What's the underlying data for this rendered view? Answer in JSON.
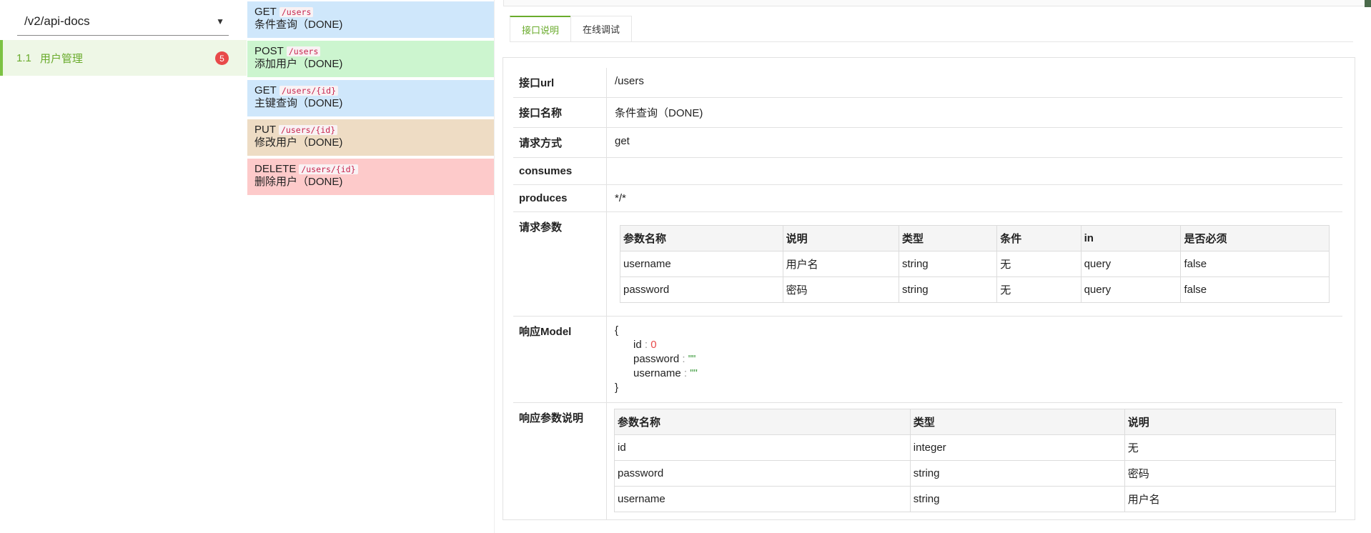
{
  "sidebar": {
    "select_value": "/v2/api-docs",
    "group": {
      "number": "1.1",
      "label": "用户管理",
      "badge": "5"
    }
  },
  "operations": [
    {
      "method": "GET",
      "path": "/users",
      "summary": "条件查询（DONE)"
    },
    {
      "method": "POST",
      "path": "/users",
      "summary": "添加用户（DONE)"
    },
    {
      "method": "GET",
      "path": "/users/{id}",
      "summary": "主键查询（DONE)"
    },
    {
      "method": "PUT",
      "path": "/users/{id}",
      "summary": "修改用户（DONE)"
    },
    {
      "method": "DELETE",
      "path": "/users/{id}",
      "summary": "删除用户（DONE)"
    }
  ],
  "tabs": [
    "接口说明",
    "在线调试"
  ],
  "details": {
    "url_label": "接口url",
    "url_value": "/users",
    "name_label": "接口名称",
    "name_value": "条件查询（DONE)",
    "method_label": "请求方式",
    "method_value": "get",
    "consumes_label": "consumes",
    "consumes_value": "",
    "produces_label": "produces",
    "produces_value": "*/*",
    "params_label": "请求参数",
    "params_headers": [
      "参数名称",
      "说明",
      "类型",
      "条件",
      "in",
      "是否必须"
    ],
    "params_rows": [
      [
        "username",
        "用户名",
        "string",
        "无",
        "query",
        "false"
      ],
      [
        "password",
        "密码",
        "string",
        "无",
        "query",
        "false"
      ]
    ],
    "model_label": "响应Model",
    "model": {
      "open": "{",
      "fields": [
        {
          "key": "id",
          "sep": " : ",
          "value": "0"
        },
        {
          "key": "password",
          "sep": " : ",
          "value": "\"\""
        },
        {
          "key": "username",
          "sep": " : ",
          "value": "\"\""
        }
      ],
      "close": "}"
    },
    "resp_label": "响应参数说明",
    "resp_headers": [
      "参数名称",
      "类型",
      "说明"
    ],
    "resp_rows": [
      [
        "id",
        "integer",
        "无"
      ],
      [
        "password",
        "string",
        "密码"
      ],
      [
        "username",
        "string",
        "用户名"
      ]
    ]
  },
  "colors": {
    "accent": "#6aab2c",
    "badge": "#e84a4a",
    "get": "#cfe7fb",
    "post": "#ccf5cf",
    "put": "#eedcc4",
    "delete": "#fdcaca"
  }
}
